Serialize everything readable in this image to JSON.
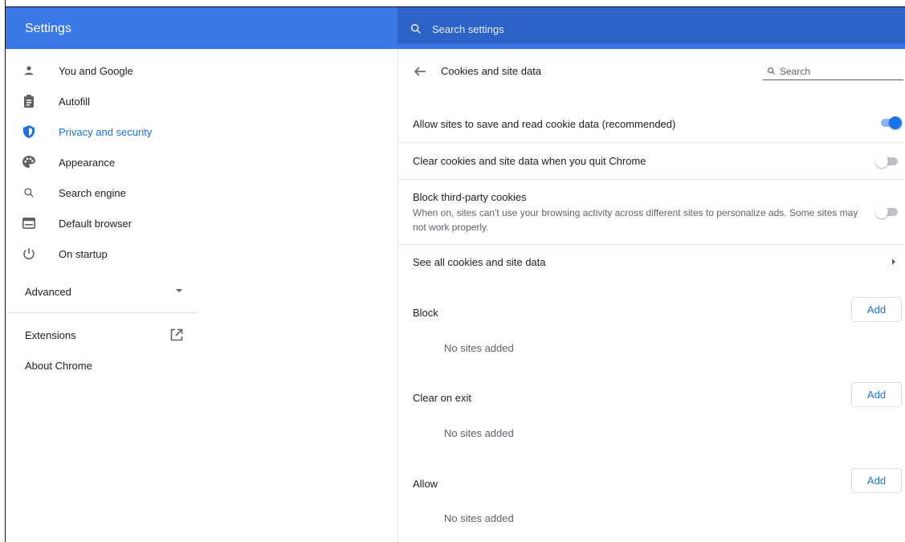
{
  "header": {
    "title": "Settings",
    "search_placeholder": "Search settings"
  },
  "sidebar": {
    "items": [
      {
        "label": "You and Google",
        "icon": "person-icon"
      },
      {
        "label": "Autofill",
        "icon": "clipboard-icon"
      },
      {
        "label": "Privacy and security",
        "icon": "shield-icon",
        "active": true
      },
      {
        "label": "Appearance",
        "icon": "palette-icon"
      },
      {
        "label": "Search engine",
        "icon": "search-icon"
      },
      {
        "label": "Default browser",
        "icon": "browser-window-icon"
      },
      {
        "label": "On startup",
        "icon": "power-icon"
      }
    ],
    "advanced_label": "Advanced",
    "extensions_label": "Extensions",
    "about_label": "About Chrome"
  },
  "main": {
    "page_title": "Cookies and site data",
    "search_placeholder": "Search",
    "settings": [
      {
        "label": "Allow sites to save and read cookie data (recommended)",
        "enabled": true
      },
      {
        "label": "Clear cookies and site data when you quit Chrome",
        "enabled": false
      },
      {
        "label": "Block third-party cookies",
        "sublabel": "When on, sites can't use your browsing activity across different sites to personalize ads. Some sites may not work properly.",
        "enabled": false
      }
    ],
    "see_all_label": "See all cookies and site data",
    "sections": [
      {
        "label": "Block",
        "add_label": "Add",
        "empty_text": "No sites added"
      },
      {
        "label": "Clear on exit",
        "add_label": "Add",
        "empty_text": "No sites added"
      },
      {
        "label": "Allow",
        "add_label": "Add",
        "empty_text": "No sites added"
      }
    ]
  },
  "colors": {
    "header_blue": "#3b78e7",
    "search_bar_blue": "#2d62c6",
    "accent": "#1a73e8"
  }
}
